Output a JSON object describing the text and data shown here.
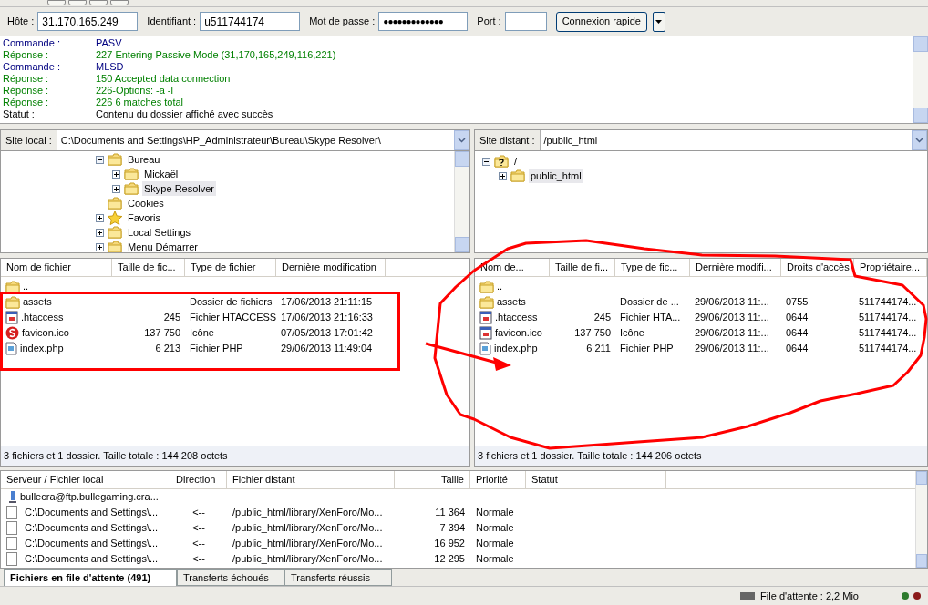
{
  "quickconnect": {
    "fields": [
      {
        "label": "Hôte :",
        "value": "31.170.165.249",
        "kind": "text"
      },
      {
        "label": "Identifiant :",
        "value": "u511744174",
        "kind": "text"
      },
      {
        "label": "Mot de passe :",
        "value": "●●●●●●●●●●●●●",
        "kind": "password"
      },
      {
        "label": "Port :",
        "kind": "port"
      }
    ],
    "button": "Connexion rapide"
  },
  "log": [
    {
      "label": "Commande :",
      "message": "PASV",
      "kind": "command"
    },
    {
      "label": "Réponse :",
      "message": "227 Entering Passive Mode (31,170,165,249,116,221)",
      "kind": "response"
    },
    {
      "label": "Commande :",
      "message": "MLSD",
      "kind": "command"
    },
    {
      "label": "Réponse :",
      "message": "150 Accepted data connection",
      "kind": "response"
    },
    {
      "label": "Réponse :",
      "message": "226-Options: -a -l",
      "kind": "response"
    },
    {
      "label": "Réponse :",
      "message": "226 6 matches total",
      "kind": "response"
    },
    {
      "label": "Statut :",
      "message": "Contenu du dossier affiché avec succès",
      "kind": "status"
    }
  ],
  "local": {
    "site_label": "Site local :",
    "path": "C:\\Documents and Settings\\HP_Administrateur\\Bureau\\Skype Resolver\\",
    "tree": [
      {
        "label": "Bureau",
        "kind": "folder",
        "expanded": true,
        "selected": false,
        "children": [
          {
            "label": "Mickaël",
            "kind": "folder",
            "expanded": false,
            "selected": false
          },
          {
            "label": "Skype Resolver",
            "kind": "folder",
            "expanded": false,
            "selected": true
          }
        ]
      },
      {
        "label": "Cookies",
        "kind": "leaf",
        "selected": false
      },
      {
        "label": "Favoris",
        "kind": "star",
        "expanded": false,
        "selected": false
      },
      {
        "label": "Local Settings",
        "kind": "folder",
        "expanded": false,
        "selected": false
      },
      {
        "label": "Menu Démarrer",
        "kind": "folder",
        "expanded": false,
        "selected": false
      }
    ],
    "columns": [
      "Nom de fichier",
      "Taille de fic...",
      "Type de fichier",
      "Dernière modification"
    ],
    "rows": [
      {
        "kind": "folder",
        "cells": [
          "..",
          "",
          "",
          ""
        ]
      },
      {
        "kind": "folder",
        "cells": [
          "assets",
          "",
          "Dossier de fichiers",
          "17/06/2013 21:11:15"
        ]
      },
      {
        "kind": "config",
        "cells": [
          ".htaccess",
          "245",
          "Fichier HTACCESS",
          "17/06/2013 21:16:33"
        ]
      },
      {
        "kind": "badge",
        "cells": [
          "favicon.ico",
          "137 750",
          "Icône",
          "07/05/2013 17:01:42"
        ]
      },
      {
        "kind": "document",
        "cells": [
          "index.php",
          "6 213",
          "Fichier PHP",
          "29/06/2013 11:49:04"
        ]
      }
    ],
    "summary": "3 fichiers et 1 dossier. Taille totale : 144 208 octets"
  },
  "remote": {
    "site_label": "Site distant :",
    "path": "/public_html",
    "tree": [
      {
        "label": "/",
        "kind": "unknown",
        "expanded": true,
        "selected": false,
        "children": [
          {
            "label": "public_html",
            "kind": "folder",
            "expanded": false,
            "selected": true
          }
        ]
      }
    ],
    "columns": [
      "Nom de...",
      "Taille de fi...",
      "Type de fic...",
      "Dernière modifi...",
      "Droits d'accès",
      "Propriétaire..."
    ],
    "rows": [
      {
        "kind": "folder",
        "cells": [
          "..",
          "",
          "",
          "",
          "",
          ""
        ]
      },
      {
        "kind": "folder",
        "cells": [
          "assets",
          "",
          "Dossier de ...",
          "29/06/2013 11:...",
          "0755",
          "511744174..."
        ]
      },
      {
        "kind": "config",
        "cells": [
          ".htaccess",
          "245",
          "Fichier HTA...",
          "29/06/2013 11:...",
          "0644",
          "511744174..."
        ]
      },
      {
        "kind": "config",
        "cells": [
          "favicon.ico",
          "137 750",
          "Icône",
          "29/06/2013 11:...",
          "0644",
          "511744174..."
        ]
      },
      {
        "kind": "document",
        "cells": [
          "index.php",
          "6 211",
          "Fichier PHP",
          "29/06/2013 11:...",
          "0644",
          "511744174..."
        ]
      }
    ],
    "summary": "3 fichiers et 1 dossier. Taille totale : 144 206 octets"
  },
  "queue": {
    "columns": [
      "Serveur / Fichier local",
      "Direction",
      "Fichier distant",
      "Taille",
      "Priorité",
      "Statut"
    ],
    "rows": [
      {
        "kind": "server",
        "cells": [
          "bullecra@ftp.bullegaming.cra..."
        ]
      },
      {
        "kind": "file",
        "cells": [
          "C:\\Documents and Settings\\...",
          "<--",
          "/public_html/library/XenForo/Mo...",
          "11 364",
          "Normale"
        ]
      },
      {
        "kind": "file",
        "cells": [
          "C:\\Documents and Settings\\...",
          "<--",
          "/public_html/library/XenForo/Mo...",
          "7 394",
          "Normale"
        ]
      },
      {
        "kind": "file",
        "cells": [
          "C:\\Documents and Settings\\...",
          "<--",
          "/public_html/library/XenForo/Mo...",
          "16 952",
          "Normale"
        ]
      },
      {
        "kind": "file",
        "cells": [
          "C:\\Documents and Settings\\...",
          "<--",
          "/public_html/library/XenForo/Mo...",
          "12 295",
          "Normale"
        ]
      }
    ],
    "tabs": [
      {
        "label": "Fichiers en file d'attente (491)",
        "selected": true
      },
      {
        "label": "Transferts échoués",
        "selected": false
      },
      {
        "label": "Transferts réussis",
        "selected": false
      }
    ]
  },
  "status_bar": {
    "queue": "File d'attente : 2,2 Mio"
  }
}
